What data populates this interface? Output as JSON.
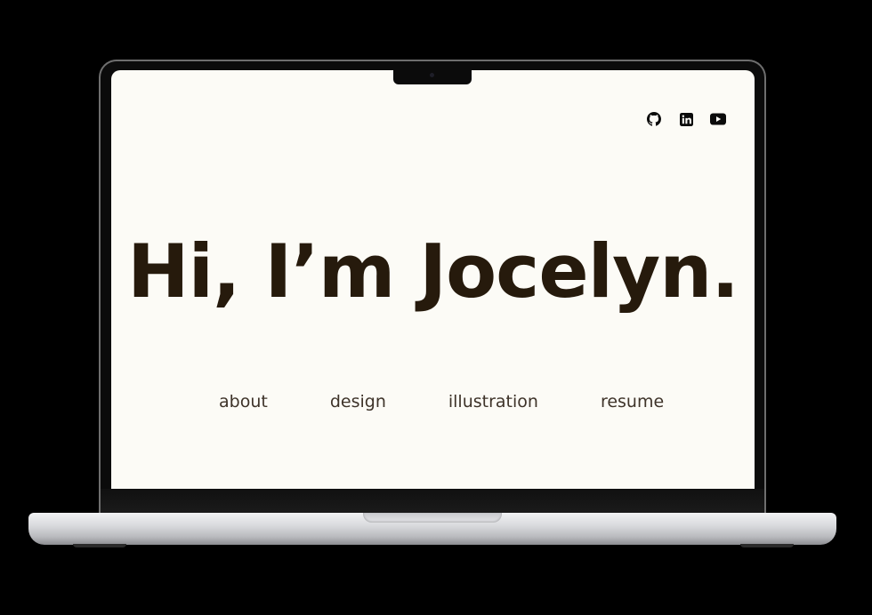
{
  "hero": {
    "heading": "Hi, I’m Jocelyn."
  },
  "nav": {
    "links": [
      {
        "label": "about"
      },
      {
        "label": "design"
      },
      {
        "label": "illustration"
      },
      {
        "label": "resume"
      }
    ]
  },
  "socials": [
    {
      "icon": "github-icon"
    },
    {
      "icon": "linkedin-icon"
    },
    {
      "icon": "youtube-icon"
    }
  ],
  "colors": {
    "background": "#fcfbf6",
    "heading": "#261a0c",
    "nav_text": "#3e3329",
    "icon": "#0b0b0b"
  }
}
